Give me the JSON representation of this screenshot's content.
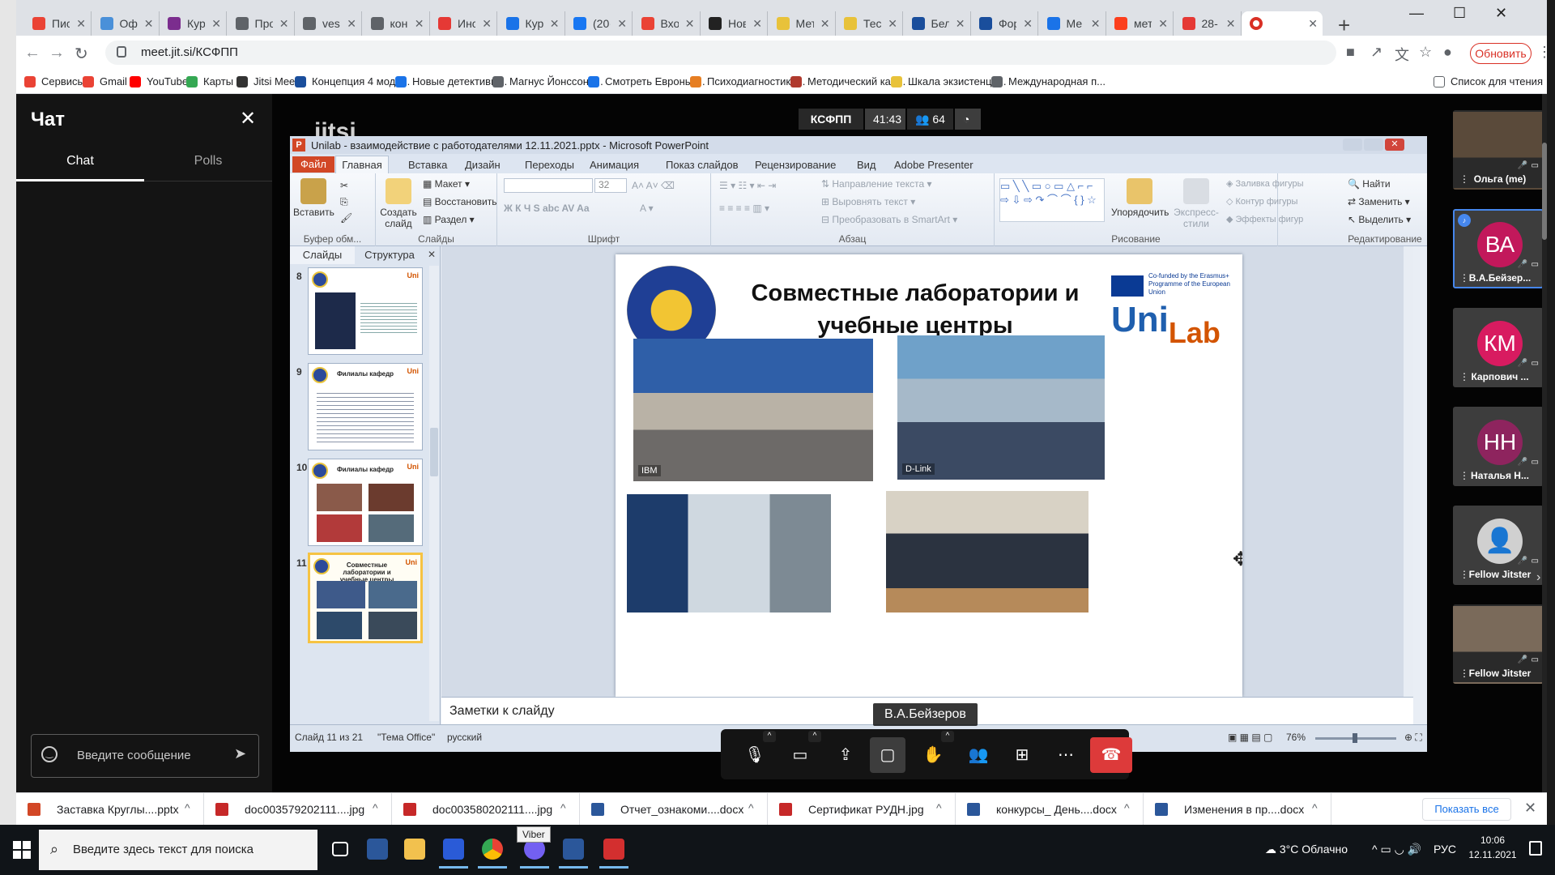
{
  "browser": {
    "tabs": [
      {
        "label": "Пис",
        "color": "#ea4335"
      },
      {
        "label": "Офі",
        "color": "#4a90d9"
      },
      {
        "label": "Кур",
        "color": "#7b2d8e"
      },
      {
        "label": "Про",
        "color": "#5f6368"
      },
      {
        "label": "vest",
        "color": "#5f6368"
      },
      {
        "label": "кон",
        "color": "#5f6368"
      },
      {
        "label": "Инс",
        "color": "#e53935"
      },
      {
        "label": "Кур",
        "color": "#1a73e8"
      },
      {
        "label": "(20·",
        "color": "#1877f2"
      },
      {
        "label": "Вхо",
        "color": "#ea4335"
      },
      {
        "label": "Нов",
        "color": "#222222"
      },
      {
        "label": "Мет",
        "color": "#e8c23a"
      },
      {
        "label": "Тес",
        "color": "#e8c23a"
      },
      {
        "label": "Бел",
        "color": "#1a4e9c"
      },
      {
        "label": "Фор",
        "color": "#1a4e9c"
      },
      {
        "label": "Ме",
        "color": "#1a73e8"
      },
      {
        "label": "мет",
        "color": "#fc3f1d"
      },
      {
        "label": "28-",
        "color": "#e53935"
      }
    ],
    "active_tab_icon": "jitsi-recording-icon",
    "url": "meet.jit.si/КСФПП",
    "update_button": "Обновить",
    "bookmarks": [
      {
        "label": "Сервисы",
        "color": "#ea4335"
      },
      {
        "label": "Gmail",
        "color": "#ea4335"
      },
      {
        "label": "YouTube",
        "color": "#ff0000"
      },
      {
        "label": "Карты",
        "color": "#34a853"
      },
      {
        "label": "Jitsi Meet",
        "color": "#333333"
      },
      {
        "label": "Концепция 4 мода...",
        "color": "#1a4e9c"
      },
      {
        "label": "Новые детективы...",
        "color": "#1a73e8"
      },
      {
        "label": "Магнус Йонссон |...",
        "color": "#5f6368"
      },
      {
        "label": "Смотреть Евроньо...",
        "color": "#1a73e8"
      },
      {
        "label": "Психодиагностика...",
        "color": "#e67e22"
      },
      {
        "label": "Методический каб...",
        "color": "#b03a2e"
      },
      {
        "label": "Шкала экзистенци...",
        "color": "#e8c23a"
      },
      {
        "label": "Международная п...",
        "color": "#5f6368"
      }
    ],
    "reading_list": "Список для чтения"
  },
  "chat": {
    "title": "Чат",
    "tab_chat": "Chat",
    "tab_polls": "Polls",
    "input_placeholder": "Введите сообщение"
  },
  "meeting": {
    "logo": "jitsi",
    "room": "КСФПП",
    "timer": "41:43",
    "participants": "64",
    "speaker_label": "В.А.Бейзеров"
  },
  "ppt": {
    "window_title": "Unilab - взаимодействие с работодателями 12.11.2021.pptx - Microsoft PowerPoint",
    "tabs": [
      "Файл",
      "Главная",
      "Вставка",
      "Дизайн",
      "Переходы",
      "Анимация",
      "Показ слайдов",
      "Рецензирование",
      "Вид",
      "Adobe Presenter"
    ],
    "ribbon": {
      "paste": "Вставить",
      "new_slide": "Создать слайд",
      "layout": "Макет",
      "restore": "Восстановить",
      "section": "Раздел",
      "font_size": "32",
      "text_direction": "Направление текста",
      "align_text": "Выровнять текст",
      "smartart": "Преобразовать в SmartArt",
      "arrange": "Упорядочить",
      "quick_styles": "Экспресс-стили",
      "fill": "Заливка фигуры",
      "outline": "Контур фигуры",
      "effects": "Эффекты фигур",
      "find": "Найти",
      "replace": "Заменить",
      "select": "Выделить",
      "groups": [
        "Буфер обм...",
        "Слайды",
        "Шрифт",
        "Абзац",
        "Рисование",
        "Редактирование"
      ]
    },
    "pane_tabs": [
      "Слайды",
      "Структура"
    ],
    "thumbs": [
      {
        "num": "8",
        "title": ""
      },
      {
        "num": "9",
        "title": "Филиалы кафедр"
      },
      {
        "num": "10",
        "title": "Филиалы кафедр"
      },
      {
        "num": "11",
        "title": "Совместные лаборатории и учебные центры"
      }
    ],
    "slide": {
      "title": "Совместные лаборатории и учебные центры",
      "eu_text": "Co-funded by the Erasmus+ Programme of the European Union",
      "logo_uni": "Uni",
      "logo_lab": "Lab",
      "photo_ibm": "IBM",
      "photo_dlink": "D-Link"
    },
    "notes": "Заметки к слайду",
    "status": {
      "slide": "Слайд 11 из 21",
      "theme": "\"Тема Office\"",
      "lang": "русский",
      "zoom": "76%"
    }
  },
  "filmstrip": [
    {
      "name": "Ольга (me)",
      "initials": "",
      "color": "#5a4a3a",
      "type": "photo"
    },
    {
      "name": "В.А.Бейзер...",
      "initials": "ВА",
      "color": "#c2185b",
      "type": "avatar",
      "dominant": true
    },
    {
      "name": "Карпович ...",
      "initials": "КМ",
      "color": "#d81b60",
      "type": "avatar"
    },
    {
      "name": "Наталья Н...",
      "initials": "НН",
      "color": "#8e245e",
      "type": "avatar"
    },
    {
      "name": "Fellow Jitster",
      "initials": "",
      "color": "#d0d0d0",
      "type": "generic"
    },
    {
      "name": "Fellow Jitster",
      "initials": "",
      "color": "#7a6a5a",
      "type": "photo"
    }
  ],
  "downloads": [
    {
      "name": "Заставка Круглы....pptx",
      "color": "#d24726"
    },
    {
      "name": "doc003579202111....jpg",
      "color": "#c62828"
    },
    {
      "name": "doc003580202111....jpg",
      "color": "#c62828"
    },
    {
      "name": "Отчет_ознакоми....docx",
      "color": "#2b579a"
    },
    {
      "name": "Сертификат РУДН.jpg",
      "color": "#c62828"
    },
    {
      "name": "конкурсы_ День....docx",
      "color": "#2b579a"
    },
    {
      "name": "Изменения в пр....docx",
      "color": "#2b579a"
    }
  ],
  "show_all": "Показать все",
  "taskbar": {
    "search_placeholder": "Введите здесь текст для поиска",
    "tooltip": "Viber",
    "weather": "3°C  Облачно",
    "lang": "РУС",
    "time": "10:06",
    "date": "12.11.2021"
  }
}
